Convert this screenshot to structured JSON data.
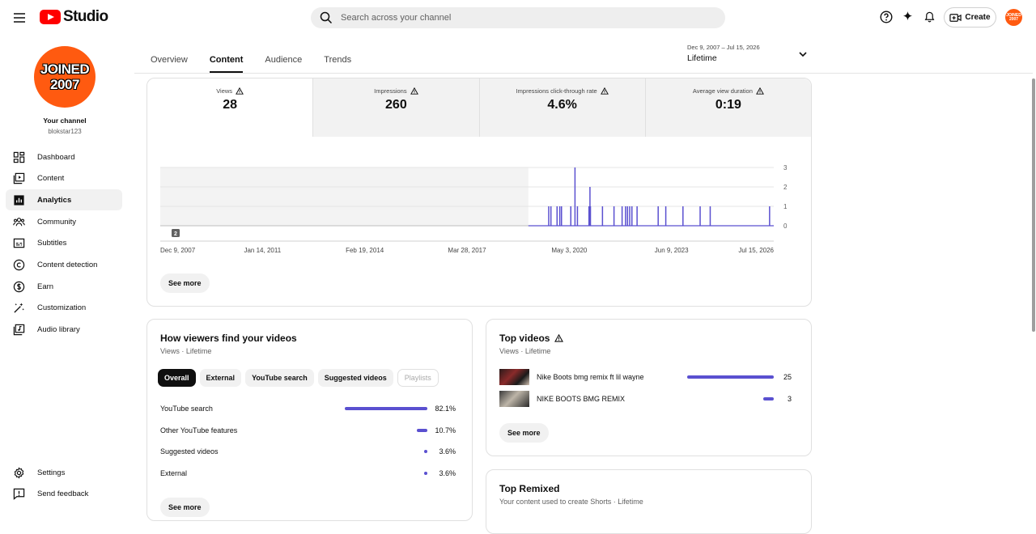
{
  "app": {
    "logo_text": "Studio"
  },
  "search": {
    "placeholder": "Search across your channel"
  },
  "header": {
    "create_label": "Create",
    "avatar_text": "JOINED 2007"
  },
  "channel": {
    "avatar_line1": "JOINED",
    "avatar_line2": "2007",
    "label": "Your channel",
    "handle": "blokstar123"
  },
  "nav": {
    "items": [
      {
        "label": "Dashboard",
        "icon": "dashboard-icon"
      },
      {
        "label": "Content",
        "icon": "content-icon"
      },
      {
        "label": "Analytics",
        "icon": "analytics-icon",
        "active": true
      },
      {
        "label": "Community",
        "icon": "community-icon"
      },
      {
        "label": "Subtitles",
        "icon": "subtitles-icon"
      },
      {
        "label": "Content detection",
        "icon": "copyright-icon"
      },
      {
        "label": "Earn",
        "icon": "dollar-icon"
      },
      {
        "label": "Customization",
        "icon": "magic-wand-icon"
      },
      {
        "label": "Audio library",
        "icon": "audio-library-icon"
      }
    ],
    "bottom": [
      {
        "label": "Settings",
        "icon": "gear-icon"
      },
      {
        "label": "Send feedback",
        "icon": "feedback-icon"
      }
    ]
  },
  "tabs": [
    {
      "label": "Overview"
    },
    {
      "label": "Content",
      "active": true
    },
    {
      "label": "Audience"
    },
    {
      "label": "Trends"
    }
  ],
  "date_range": {
    "dates": "Dec 9, 2007 – Jul 15, 2026",
    "label": "Lifetime"
  },
  "metrics": [
    {
      "label": "Views",
      "value": "28"
    },
    {
      "label": "Impressions",
      "value": "260"
    },
    {
      "label": "Impressions click-through rate",
      "value": "4.6%"
    },
    {
      "label": "Average view duration",
      "value": "0:19"
    }
  ],
  "chart_data": {
    "type": "bar",
    "x_tick_labels": [
      "Dec 9, 2007",
      "Jan 14, 2011",
      "Feb 19, 2014",
      "Mar 28, 2017",
      "May 3, 2020",
      "Jun 9, 2023",
      "Jul 15, 2026"
    ],
    "y_tick_labels": [
      "0",
      "1",
      "2",
      "3"
    ],
    "ylim": [
      0,
      3
    ],
    "grid": true,
    "no_data_before_fraction": 0.6,
    "marker_label": "2",
    "daily_views": [
      {
        "t": 0.083,
        "v": 1
      },
      {
        "t": 0.092,
        "v": 1
      },
      {
        "t": 0.117,
        "v": 1
      },
      {
        "t": 0.128,
        "v": 1
      },
      {
        "t": 0.135,
        "v": 1
      },
      {
        "t": 0.173,
        "v": 1
      },
      {
        "t": 0.19,
        "v": 3
      },
      {
        "t": 0.2,
        "v": 1
      },
      {
        "t": 0.247,
        "v": 1
      },
      {
        "t": 0.251,
        "v": 2
      },
      {
        "t": 0.253,
        "v": 1
      },
      {
        "t": 0.302,
        "v": 1
      },
      {
        "t": 0.349,
        "v": 1
      },
      {
        "t": 0.382,
        "v": 1
      },
      {
        "t": 0.396,
        "v": 1
      },
      {
        "t": 0.404,
        "v": 1
      },
      {
        "t": 0.413,
        "v": 1
      },
      {
        "t": 0.422,
        "v": 1
      },
      {
        "t": 0.443,
        "v": 1
      },
      {
        "t": 0.529,
        "v": 1
      },
      {
        "t": 0.56,
        "v": 1
      },
      {
        "t": 0.63,
        "v": 1
      },
      {
        "t": 0.7,
        "v": 1
      },
      {
        "t": 0.741,
        "v": 1
      },
      {
        "t": 0.983,
        "v": 1
      }
    ]
  },
  "see_more": "See more",
  "traffic": {
    "title": "How viewers find your videos",
    "subtitle": "Views · Lifetime",
    "chips": [
      "Overall",
      "External",
      "YouTube search",
      "Suggested videos",
      "Playlists"
    ],
    "rows": [
      {
        "label": "YouTube search",
        "pct": "82.1%",
        "value": 82.1
      },
      {
        "label": "Other YouTube features",
        "pct": "10.7%",
        "value": 10.7
      },
      {
        "label": "Suggested videos",
        "pct": "3.6%",
        "value": 3.6
      },
      {
        "label": "External",
        "pct": "3.6%",
        "value": 3.6
      }
    ]
  },
  "top_videos": {
    "title": "Top videos",
    "subtitle": "Views · Lifetime",
    "rows": [
      {
        "title": "Nike Boots bmg remix ft lil wayne",
        "views": "25",
        "value": 25
      },
      {
        "title": "NIKE BOOTS BMG REMIX",
        "views": "3",
        "value": 3
      }
    ]
  },
  "top_remixed": {
    "title": "Top Remixed",
    "subtitle": "Your content used to create Shorts · Lifetime"
  }
}
